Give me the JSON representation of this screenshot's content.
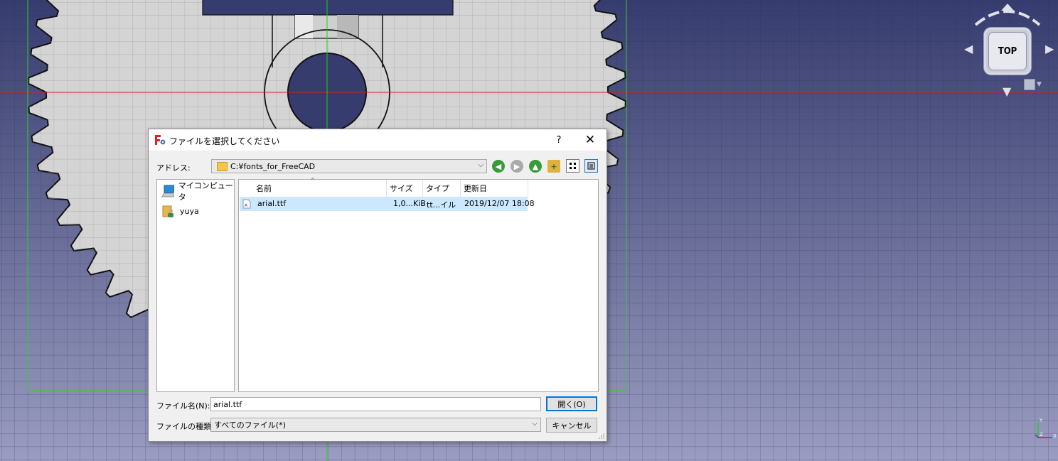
{
  "viewport": {
    "navcube_face": "TOP",
    "axis_labels": {
      "x": "X",
      "y": "Y",
      "z": "Z"
    },
    "colors": {
      "bg_top": "#363c6e",
      "bg_bottom": "#9a9cc0",
      "gear": "#d4d4d4",
      "axis_red": "#cc2222",
      "axis_green": "#22cc22"
    }
  },
  "dialog": {
    "title": "ファイルを選択してください",
    "help": "?",
    "close": "✕",
    "address_label": "アドレス:",
    "address_value": "C:¥fonts_for_FreeCAD",
    "toolbar_icons": [
      "back-icon",
      "forward-icon",
      "up-icon",
      "new-folder-icon",
      "list-view-icon",
      "detail-view-icon"
    ],
    "sidebar": [
      {
        "label": "マイコンピュータ",
        "icon": "computer-icon"
      },
      {
        "label": "yuya",
        "icon": "user-folder-icon"
      }
    ],
    "columns": [
      "名前",
      "サイズ",
      "タイプ",
      "更新日"
    ],
    "files": [
      {
        "name": "arial.ttf",
        "size": "1,0...KiB",
        "type": "tt...イル",
        "date": "2019/12/07 18:08"
      }
    ],
    "filename_label": "ファイル名(N):",
    "filename_value": "arial.ttf",
    "filetype_label": "ファイルの種類:",
    "filetype_value": "すべてのファイル(*)",
    "open_button": "開く(O)",
    "cancel_button": "キャンセル"
  }
}
